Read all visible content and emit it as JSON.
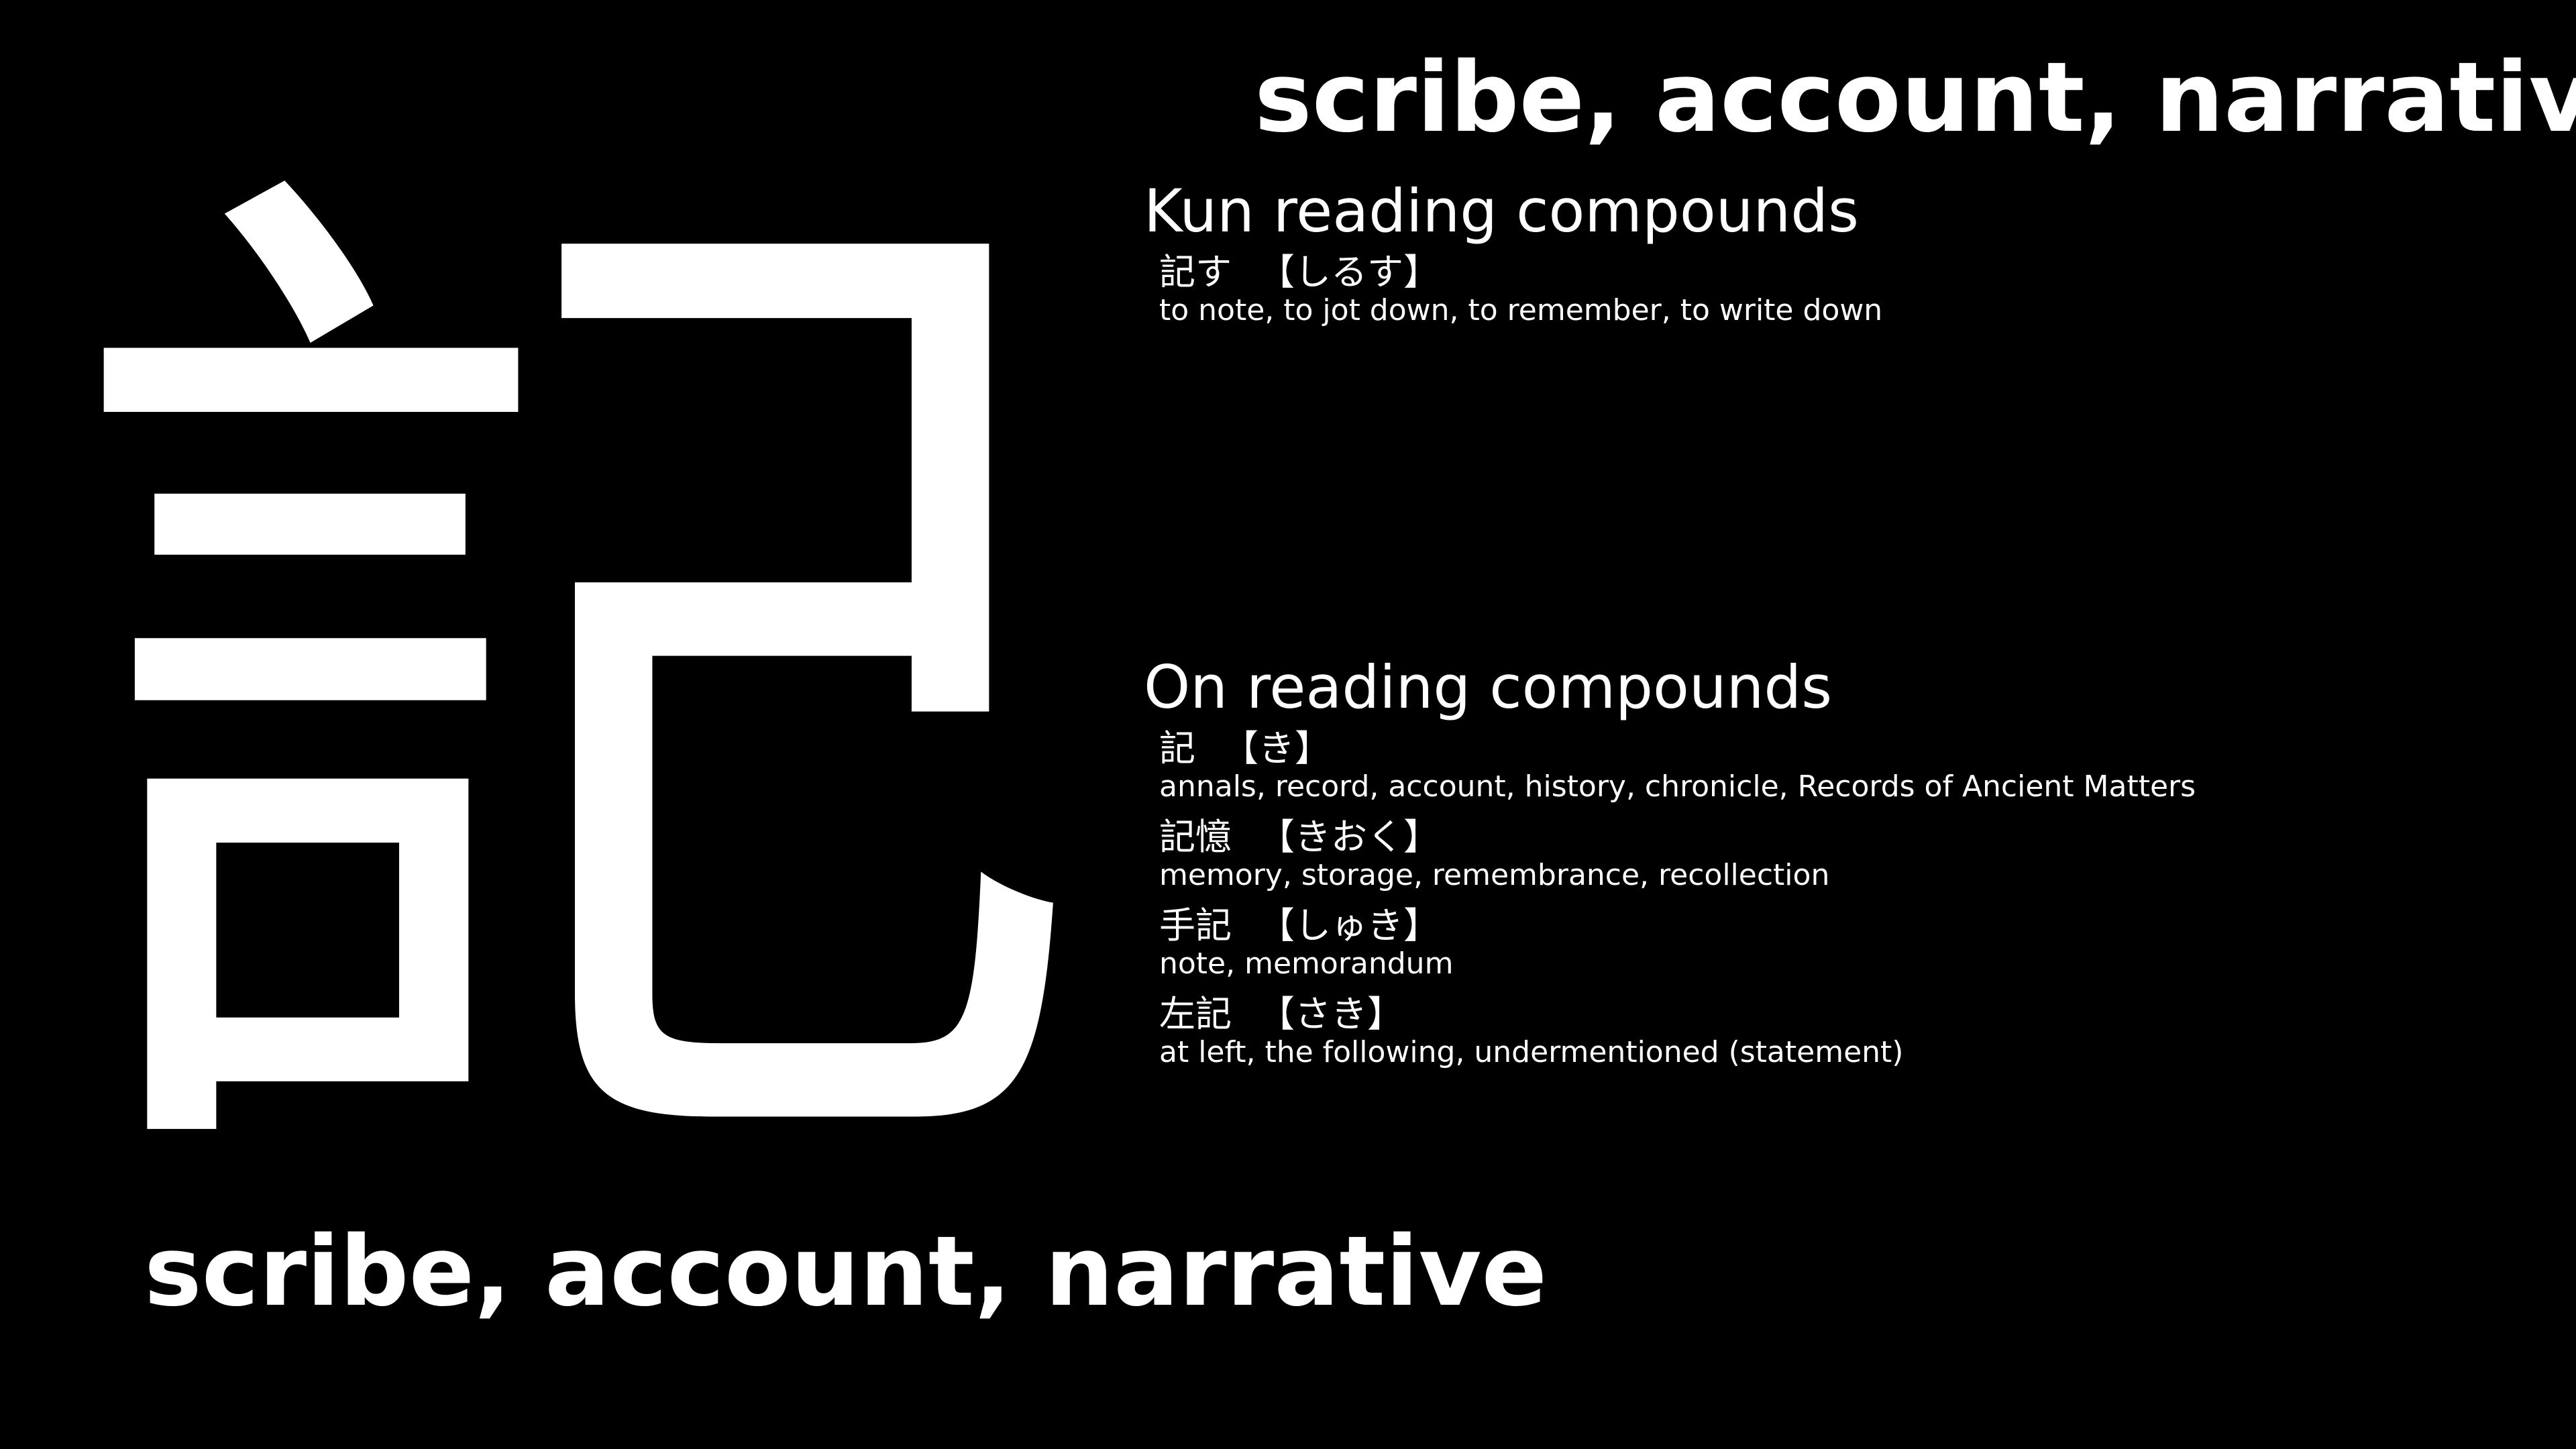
{
  "kanji": {
    "character": "記",
    "meaning": "scribe, account, narrative"
  },
  "kun": {
    "heading": "Kun reading compounds",
    "items": [
      {
        "word": "記す",
        "reading": "【しるす】",
        "meaning": "to note, to jot down, to remember, to write down"
      }
    ]
  },
  "on": {
    "heading": "On reading compounds",
    "items": [
      {
        "word": "記",
        "reading": "【き】",
        "meaning": "annals, record, account, history, chronicle, Records of Ancient Matters"
      },
      {
        "word": "記憶",
        "reading": "【きおく】",
        "meaning": "memory, storage, remembrance, recollection"
      },
      {
        "word": "手記",
        "reading": "【しゅき】",
        "meaning": "note, memorandum"
      },
      {
        "word": "左記",
        "reading": "【さき】",
        "meaning": "at left, the following, undermentioned (statement)"
      }
    ]
  },
  "colors": {
    "background": "#000000",
    "text": "#ffffff"
  }
}
